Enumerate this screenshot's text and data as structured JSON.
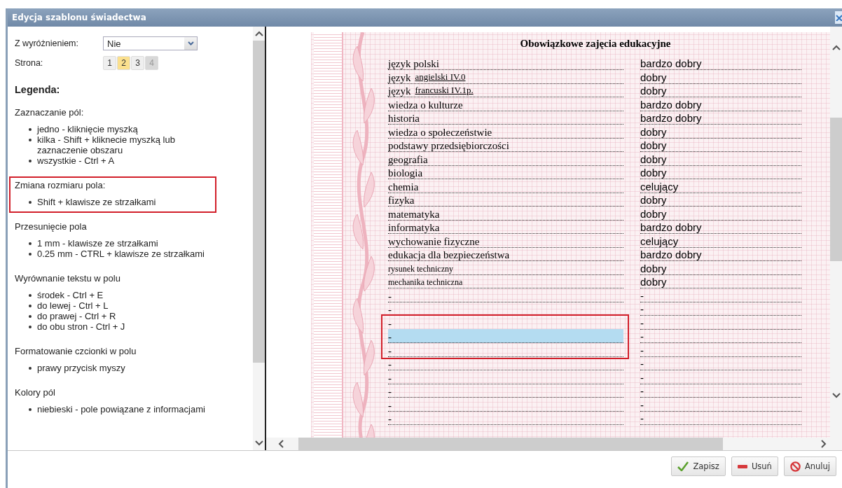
{
  "window": {
    "title": "Edycja szablonu świadectwa"
  },
  "settings": {
    "distinction_label": "Z wyróżnieniem:",
    "distinction_value": "Nie",
    "page_label": "Strona:",
    "pages": [
      {
        "label": "1",
        "selected": false,
        "disabled": false
      },
      {
        "label": "2",
        "selected": true,
        "disabled": false
      },
      {
        "label": "3",
        "selected": false,
        "disabled": false
      },
      {
        "label": "4",
        "selected": false,
        "disabled": true
      }
    ]
  },
  "legend": {
    "title": "Legenda:",
    "sections": [
      {
        "heading": "Zaznaczanie pól:",
        "highlighted": false,
        "items": [
          "jedno - kliknięcie myszką",
          "kilka - Shift + kliknecie myszką lub zaznaczenie obszaru",
          "wszystkie - Ctrl + A"
        ]
      },
      {
        "heading": "Zmiana rozmiaru pola:",
        "highlighted": true,
        "items": [
          "Shift + klawisze ze strzałkami"
        ]
      },
      {
        "heading": "Przesunięcie pola",
        "highlighted": false,
        "items": [
          "1 mm - klawisze ze strzałkami",
          "0.25 mm - CTRL + klawisze ze strzałkami"
        ]
      },
      {
        "heading": "Wyrównanie tekstu w polu",
        "highlighted": false,
        "items": [
          "środek - Ctrl + E",
          "do lewej - Ctrl + L",
          "do prawej - Ctrl + R",
          "do obu stron - Ctrl + J"
        ]
      },
      {
        "heading": "Formatowanie czcionki w polu",
        "highlighted": false,
        "items": [
          "prawy przycisk myszy"
        ]
      },
      {
        "heading": "Kolory pól",
        "highlighted": false,
        "items": [
          "niebieski - pole powiązane z informacjami"
        ]
      }
    ]
  },
  "certificate": {
    "heading": "Obowiązkowe zajęcia edukacyjne",
    "rows": [
      {
        "kind": "standard",
        "subject": "język polski",
        "grade": "bardzo dobry",
        "selected": false,
        "highlighted": false
      },
      {
        "kind": "language",
        "prefix": "język",
        "subject": "angielski  IV.0",
        "grade": "dobry",
        "selected": false,
        "highlighted": false
      },
      {
        "kind": "language",
        "prefix": "język",
        "subject": "francuski  IV.1p.",
        "grade": "dobry",
        "selected": false,
        "highlighted": false
      },
      {
        "kind": "standard",
        "subject": "wiedza o kulturze",
        "grade": "bardzo dobry",
        "selected": false,
        "highlighted": false
      },
      {
        "kind": "standard",
        "subject": "historia",
        "grade": "bardzo dobry",
        "selected": false,
        "highlighted": false
      },
      {
        "kind": "standard",
        "subject": "wiedza o społeczeństwie",
        "grade": "dobry",
        "selected": false,
        "highlighted": false
      },
      {
        "kind": "standard",
        "subject": "podstawy przedsiębiorczości",
        "grade": "dobry",
        "selected": false,
        "highlighted": false
      },
      {
        "kind": "standard",
        "subject": "geografia",
        "grade": "dobry",
        "selected": false,
        "highlighted": false
      },
      {
        "kind": "standard",
        "subject": "biologia",
        "grade": "dobry",
        "selected": false,
        "highlighted": false
      },
      {
        "kind": "standard",
        "subject": "chemia",
        "grade": "celujący",
        "selected": false,
        "highlighted": false
      },
      {
        "kind": "standard",
        "subject": "fizyka",
        "grade": "dobry",
        "selected": false,
        "highlighted": false
      },
      {
        "kind": "standard",
        "subject": "matematyka",
        "grade": "dobry",
        "selected": false,
        "highlighted": false
      },
      {
        "kind": "standard",
        "subject": "informatyka",
        "grade": "bardzo dobry",
        "selected": false,
        "highlighted": false
      },
      {
        "kind": "standard",
        "subject": "wychowanie fizyczne",
        "grade": "celujący",
        "selected": false,
        "highlighted": false
      },
      {
        "kind": "standard",
        "subject": "edukacja dla bezpieczeństwa",
        "grade": "bardzo dobry",
        "selected": false,
        "highlighted": false
      },
      {
        "kind": "custom",
        "subject": "rysunek techniczny",
        "grade": "dobry",
        "selected": false,
        "highlighted": false
      },
      {
        "kind": "custom",
        "subject": "mechanika techniczna",
        "grade": "dobry",
        "selected": false,
        "highlighted": false
      },
      {
        "kind": "blank",
        "subject": "-",
        "grade": "-",
        "selected": false,
        "highlighted": false
      },
      {
        "kind": "blank",
        "subject": "-",
        "grade": "-",
        "selected": false,
        "highlighted": false
      },
      {
        "kind": "blank",
        "subject": "-",
        "grade": "-",
        "selected": false,
        "highlighted": true
      },
      {
        "kind": "blank",
        "subject": "-",
        "grade": "-",
        "selected": true,
        "highlighted": true
      },
      {
        "kind": "blank",
        "subject": "-",
        "grade": "-",
        "selected": false,
        "highlighted": true
      },
      {
        "kind": "blank",
        "subject": "-",
        "grade": "-",
        "selected": false,
        "highlighted": false
      },
      {
        "kind": "blank",
        "subject": "-",
        "grade": "-",
        "selected": false,
        "highlighted": false
      },
      {
        "kind": "blank",
        "subject": "-",
        "grade": "-",
        "selected": false,
        "highlighted": false
      },
      {
        "kind": "blank",
        "subject": "-",
        "grade": "-",
        "selected": false,
        "highlighted": false
      },
      {
        "kind": "blank",
        "subject": "-",
        "grade": "-",
        "selected": false,
        "highlighted": false
      }
    ]
  },
  "buttons": [
    {
      "kind": "save",
      "label": "Zapisz"
    },
    {
      "kind": "delete",
      "label": "Usuń"
    },
    {
      "kind": "cancel",
      "label": "Anuluj"
    }
  ]
}
